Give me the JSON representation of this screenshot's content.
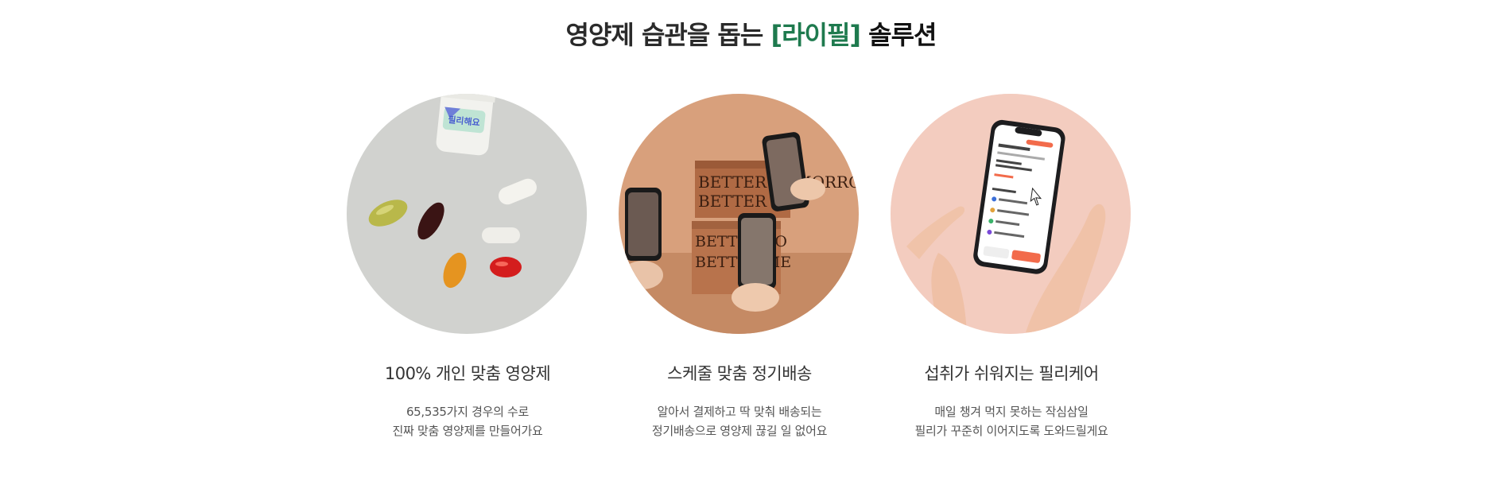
{
  "headline": {
    "prefix": "영양제 습관을 돕는",
    "brand": "[라이필]",
    "suffix": "솔루션",
    "brand_color": "#1e7a4e"
  },
  "features": [
    {
      "title": "100% 개인 맞춤 영양제",
      "desc_line1": "65,535가지 경우의 수로",
      "desc_line2": "진짜 맞춤 영양제를 만들어가요",
      "image_icon": "pills-photo",
      "label_text": "필리해요"
    },
    {
      "title": "스케줄 맞춤 정기배송",
      "desc_line1": "알아서 결제하고 딱 맞춰 배송되는",
      "desc_line2": "정기배송으로 영양제 끊길 일 없어요",
      "image_icon": "delivery-boxes-photo",
      "box_text_1": "BETTER TOMORROW",
      "box_text_2": "BETTER ME."
    },
    {
      "title": "섭취가 쉬워지는 필리케어",
      "desc_line1": "매일 챙겨 먹지 못하는 작심삼일",
      "desc_line2": "필리가 꾸준히 이어지도록 도와드릴게요",
      "image_icon": "phone-app-photo"
    }
  ]
}
